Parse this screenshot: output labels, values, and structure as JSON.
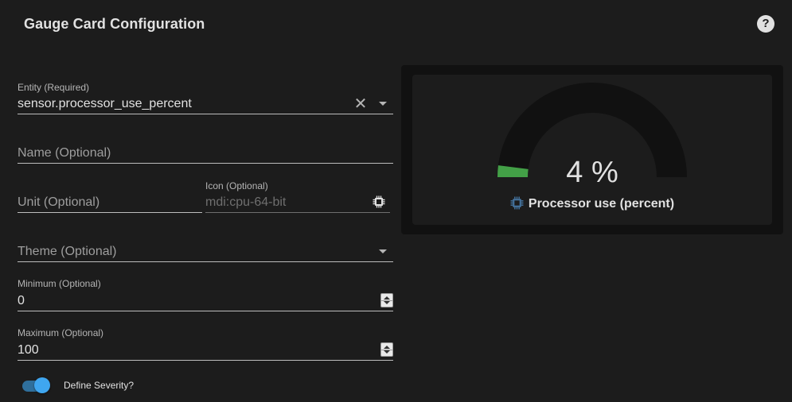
{
  "dialog": {
    "title": "Gauge Card Configuration",
    "help_icon": "?"
  },
  "form": {
    "entity": {
      "label": "Entity (Required)",
      "value": "sensor.processor_use_percent"
    },
    "name": {
      "placeholder": "Name (Optional)"
    },
    "unit": {
      "placeholder": "Unit (Optional)"
    },
    "icon": {
      "label": "Icon (Optional)",
      "value": "mdi:cpu-64-bit"
    },
    "theme": {
      "placeholder": "Theme (Optional)"
    },
    "minimum": {
      "label": "Minimum (Optional)",
      "value": "0"
    },
    "maximum": {
      "label": "Maximum (Optional)",
      "value": "100"
    },
    "severity": {
      "label": "Define Severity?",
      "enabled": true
    }
  },
  "preview": {
    "value": 4,
    "min": 0,
    "max": 100,
    "display": "4 %",
    "name": "Processor use (percent)",
    "icon": "cpu-64-bit-icon",
    "colors": {
      "fill": "#43a047",
      "track": "#111111",
      "accent": "#44739e"
    }
  }
}
